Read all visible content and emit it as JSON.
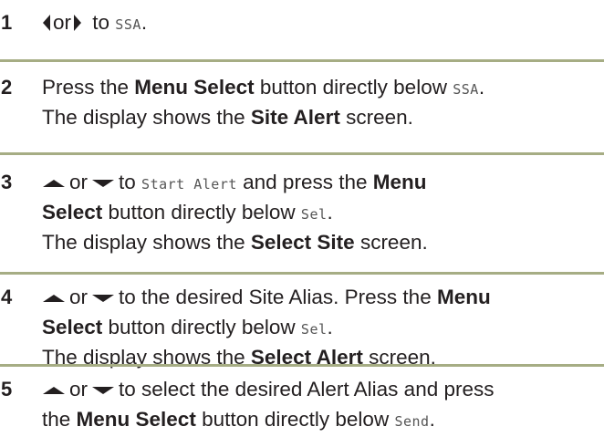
{
  "steps": [
    {
      "number": "1",
      "lines": [
        [
          {
            "icon": "left-arrow-icon"
          },
          {
            "text": "or"
          },
          {
            "icon": "right-arrow-icon"
          },
          {
            "text": " to "
          },
          {
            "text": "SSA",
            "style": "mono"
          },
          {
            "text": "."
          }
        ]
      ]
    },
    {
      "number": "2",
      "lines": [
        [
          {
            "text": "Press the "
          },
          {
            "text": "Menu Select",
            "style": "bold"
          },
          {
            "text": " button directly below "
          },
          {
            "text": "SSA",
            "style": "mono"
          },
          {
            "text": "."
          }
        ],
        [
          {
            "text": "The display shows the "
          },
          {
            "text": "Site Alert",
            "style": "bold"
          },
          {
            "text": " screen."
          }
        ]
      ]
    },
    {
      "number": "3",
      "lines": [
        [
          {
            "icon": "up-arrow-icon"
          },
          {
            "text": "or"
          },
          {
            "icon": "down-arrow-icon"
          },
          {
            "text": "to "
          },
          {
            "text": "Start Alert",
            "style": "mono"
          },
          {
            "text": " and press the "
          },
          {
            "text": "Menu",
            "style": "bold"
          }
        ],
        [
          {
            "text": "Select",
            "style": "bold"
          },
          {
            "text": " button directly below "
          },
          {
            "text": "Sel",
            "style": "mono"
          },
          {
            "text": "."
          }
        ],
        [
          {
            "text": "The display shows the "
          },
          {
            "text": "Select Site",
            "style": "bold"
          },
          {
            "text": " screen."
          }
        ]
      ]
    },
    {
      "number": "4",
      "lines": [
        [
          {
            "icon": "up-arrow-icon"
          },
          {
            "text": "or"
          },
          {
            "icon": "down-arrow-icon"
          },
          {
            "text": "to the desired Site Alias. Press the "
          },
          {
            "text": "Menu",
            "style": "bold"
          }
        ],
        [
          {
            "text": "Select",
            "style": "bold"
          },
          {
            "text": " button directly below "
          },
          {
            "text": "Sel",
            "style": "mono"
          },
          {
            "text": "."
          }
        ],
        [
          {
            "text": "The display shows the "
          },
          {
            "text": "Select Alert",
            "style": "bold"
          },
          {
            "text": " screen."
          }
        ]
      ]
    },
    {
      "number": "5",
      "lines": [
        [
          {
            "icon": "up-arrow-icon"
          },
          {
            "text": "or"
          },
          {
            "icon": "down-arrow-icon"
          },
          {
            "text": "to select the desired Alert Alias and press"
          }
        ],
        [
          {
            "text": "the "
          },
          {
            "text": "Menu Select",
            "style": "bold"
          },
          {
            "text": " button directly below "
          },
          {
            "text": "Send",
            "style": "mono"
          },
          {
            "text": "."
          }
        ]
      ]
    }
  ],
  "colors": {
    "divider": "#a6ad84",
    "text": "#231f20"
  }
}
